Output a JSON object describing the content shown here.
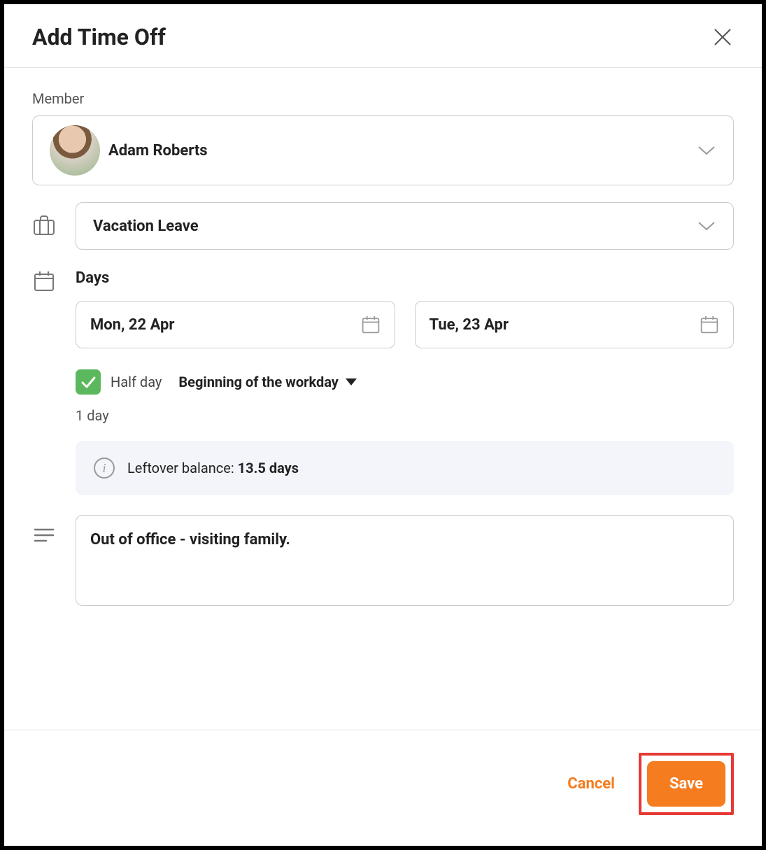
{
  "header": {
    "title": "Add Time Off"
  },
  "member": {
    "label": "Member",
    "name": "Adam Roberts"
  },
  "leave": {
    "type": "Vacation Leave"
  },
  "days": {
    "label": "Days",
    "start": "Mon, 22 Apr",
    "end": "Tue, 23 Apr"
  },
  "halfday": {
    "checked": true,
    "label": "Half day",
    "portion": "Beginning of the workday"
  },
  "duration": "1 day",
  "balance": {
    "prefix": "Leftover balance: ",
    "value": "13.5 days"
  },
  "notes": {
    "value": "Out of office - visiting family."
  },
  "footer": {
    "cancel": "Cancel",
    "save": "Save"
  }
}
